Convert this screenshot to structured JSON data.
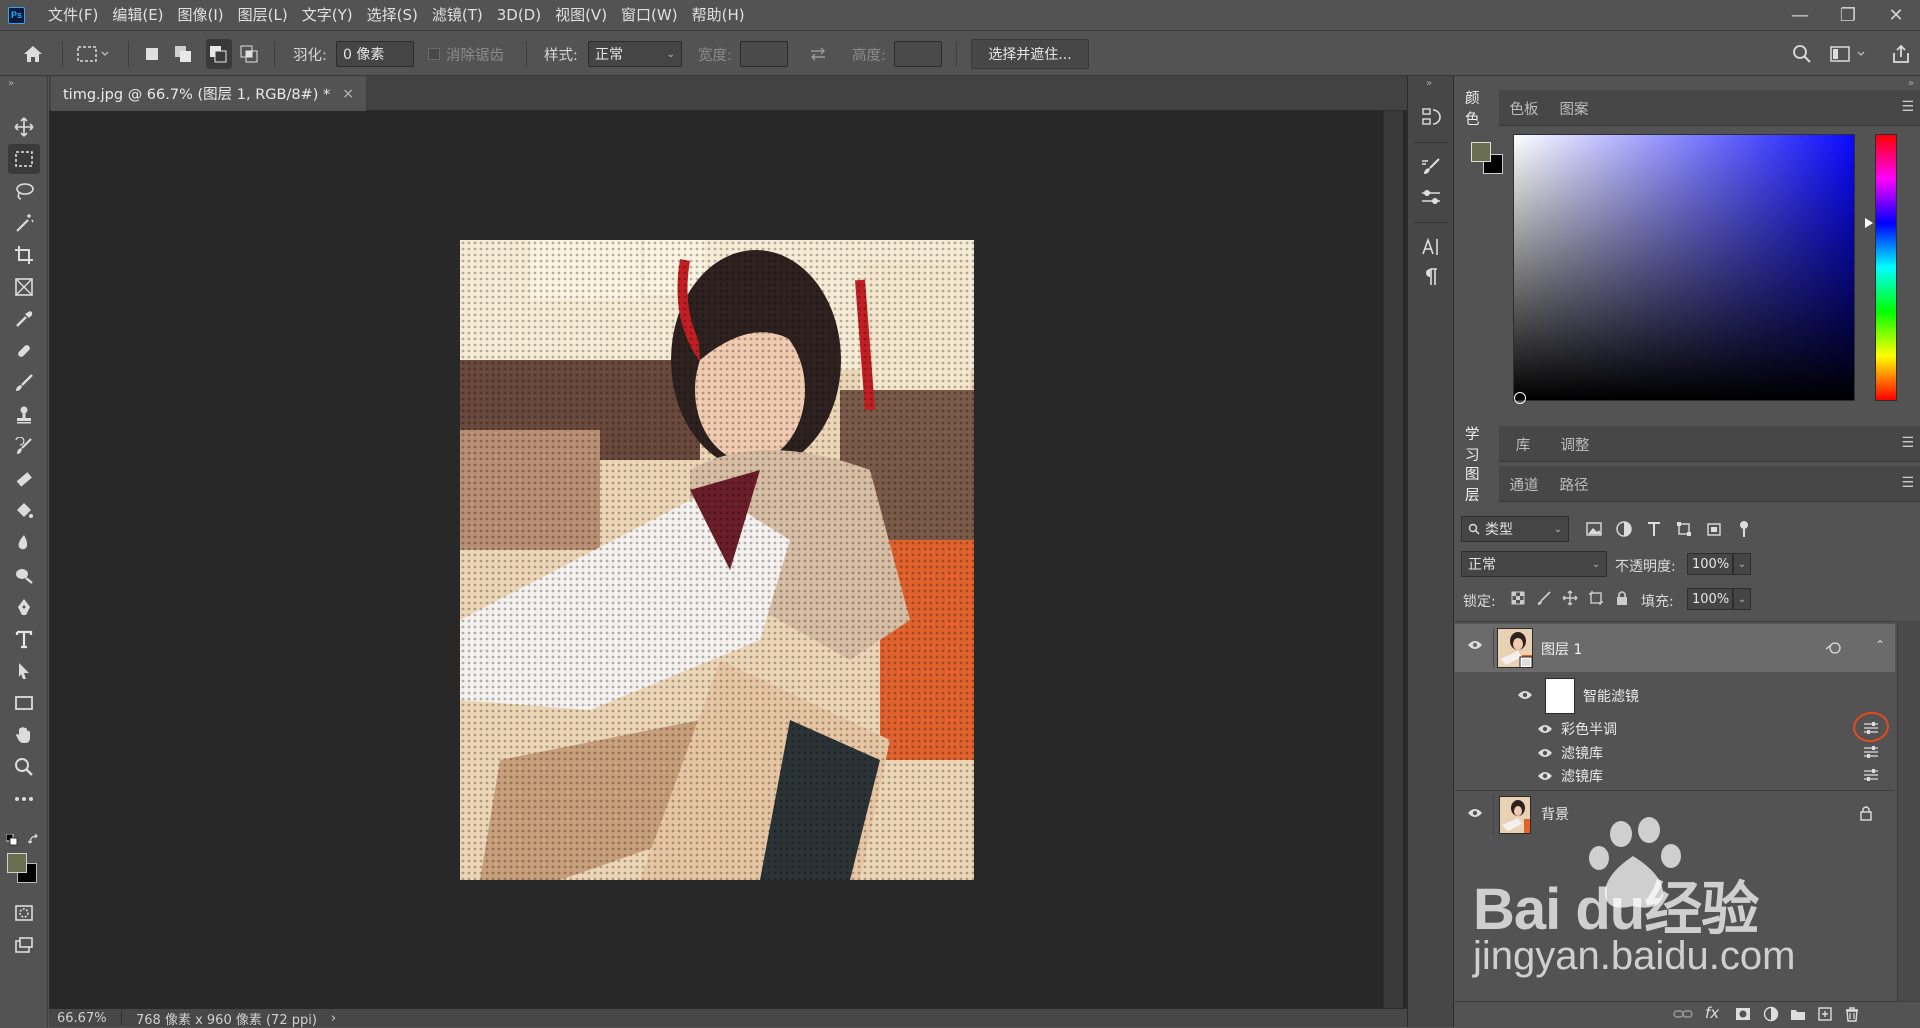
{
  "menubar": {
    "logo": "Ps",
    "items": [
      "文件(F)",
      "编辑(E)",
      "图像(I)",
      "图层(L)",
      "文字(Y)",
      "选择(S)",
      "滤镜(T)",
      "3D(D)",
      "视图(V)",
      "窗口(W)",
      "帮助(H)"
    ],
    "minimize": "—",
    "restore": "❐",
    "close": "✕"
  },
  "options": {
    "feather_label": "羽化:",
    "feather_value": "0 像素",
    "antialias_label": "消除锯齿",
    "style_label": "样式:",
    "style_value": "正常",
    "width_label": "宽度:",
    "height_label": "高度:",
    "select_mask_button": "选择并遮住..."
  },
  "document": {
    "tab_title": "timg.jpg @ 66.7% (图层 1, RGB/8#) *",
    "tab_close": "×",
    "zoom": "66.67%",
    "doc_info": "768 像素 x 960 像素 (72 ppi)",
    "status_arrow": "›"
  },
  "color_panel": {
    "tabs": [
      "颜色",
      "色板",
      "图案"
    ],
    "foreground": "#6b6f52",
    "background": "#000000"
  },
  "learn_panel": {
    "tabs": [
      "学习",
      "库",
      "调整"
    ]
  },
  "layers_panel": {
    "tabs": [
      "图层",
      "通道",
      "路径"
    ],
    "filter_kind": "类型",
    "blend_mode": "正常",
    "opacity_label": "不透明度:",
    "opacity_value": "100%",
    "lock_label": "锁定:",
    "fill_label": "填充:",
    "fill_value": "100%",
    "layers": {
      "layer1": {
        "name": "图层 1"
      },
      "smart_filters": {
        "name": "智能滤镜"
      },
      "filters": [
        "彩色半调",
        "滤镜库",
        "滤镜库"
      ],
      "background": {
        "name": "背景"
      }
    },
    "bottom_icons": [
      "link-icon",
      "fx-icon",
      "mask-icon",
      "adjustment-icon",
      "group-icon",
      "new-layer-icon",
      "trash-icon"
    ],
    "fx_label": "fx"
  },
  "watermark": {
    "brand": "Bai du经验",
    "url": "jingyan.baidu.com"
  },
  "colors": {
    "chrome": "#535353",
    "canvas_bg": "#282828",
    "hue_accent": "#0a0aff",
    "highlight_circle": "#e8491d"
  }
}
